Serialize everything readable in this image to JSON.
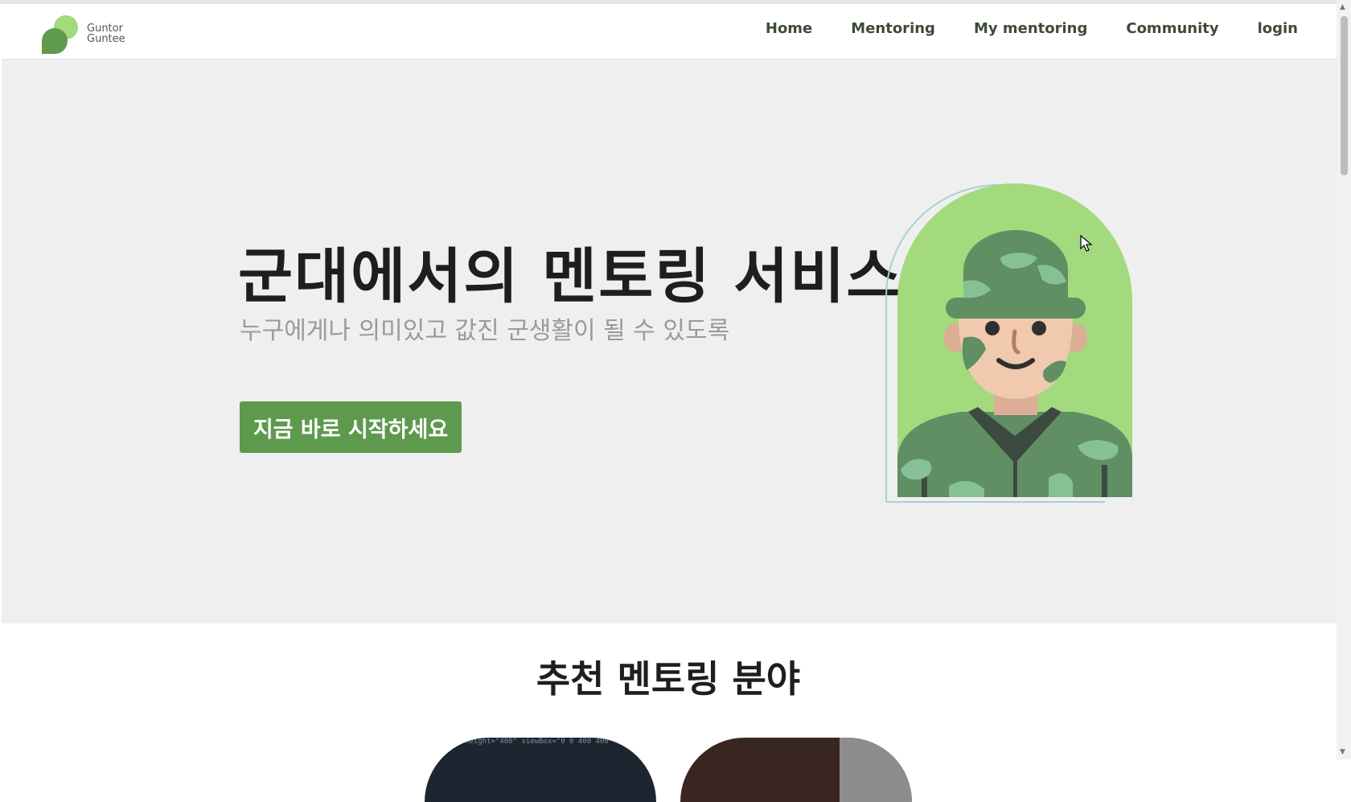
{
  "brand": {
    "line1": "Guntor",
    "line2": "Guntee",
    "colors": {
      "accent": "#5e9a4e",
      "light": "#a2da7d"
    }
  },
  "nav": [
    {
      "label": "Home"
    },
    {
      "label": "Mentoring"
    },
    {
      "label": "My mentoring"
    },
    {
      "label": "Community"
    },
    {
      "label": "login"
    }
  ],
  "hero": {
    "title": "군대에서의 멘토링 서비스",
    "subtitle": "누구에게나 의미있고 값진 군생활이 될 수 있도록",
    "cta_label": "지금 바로 시작하세요",
    "illustration_icon": "soldier-avatar-icon"
  },
  "recommend": {
    "title": "추천 멘토링 분야",
    "cards": [
      {
        "code_snippet": "height=\"400\" viewBox=\"0 0 400 400\" xmlns="
      },
      {
        "code_snippet": ""
      }
    ]
  }
}
